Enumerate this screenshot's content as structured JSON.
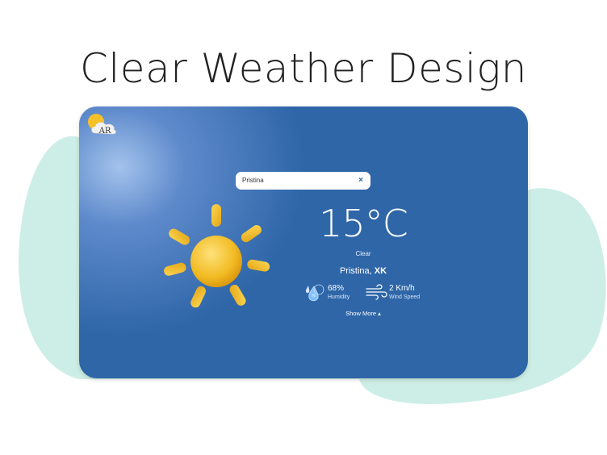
{
  "page": {
    "title": "Clear Weather Design"
  },
  "colors": {
    "card": "#2e66a8",
    "blob": "#cdeee6",
    "sun": "#f5c12a"
  },
  "logo": {
    "icon": "cloud-sun-logo-icon",
    "text": "AR"
  },
  "search": {
    "value": "Pristina",
    "clear_icon": "close-icon",
    "clear_label": "×"
  },
  "weather": {
    "temperature": "15°C",
    "condition": "Clear",
    "city": "Pristina,",
    "country": "XK",
    "humidity": {
      "value": "68%",
      "label": "Humidity",
      "icon": "humidity-drop-icon"
    },
    "wind": {
      "value": "2 Km/h",
      "label": "Wind Speed",
      "icon": "wind-icon"
    },
    "show_more": "Show More ▴",
    "icon": "sun-icon"
  }
}
